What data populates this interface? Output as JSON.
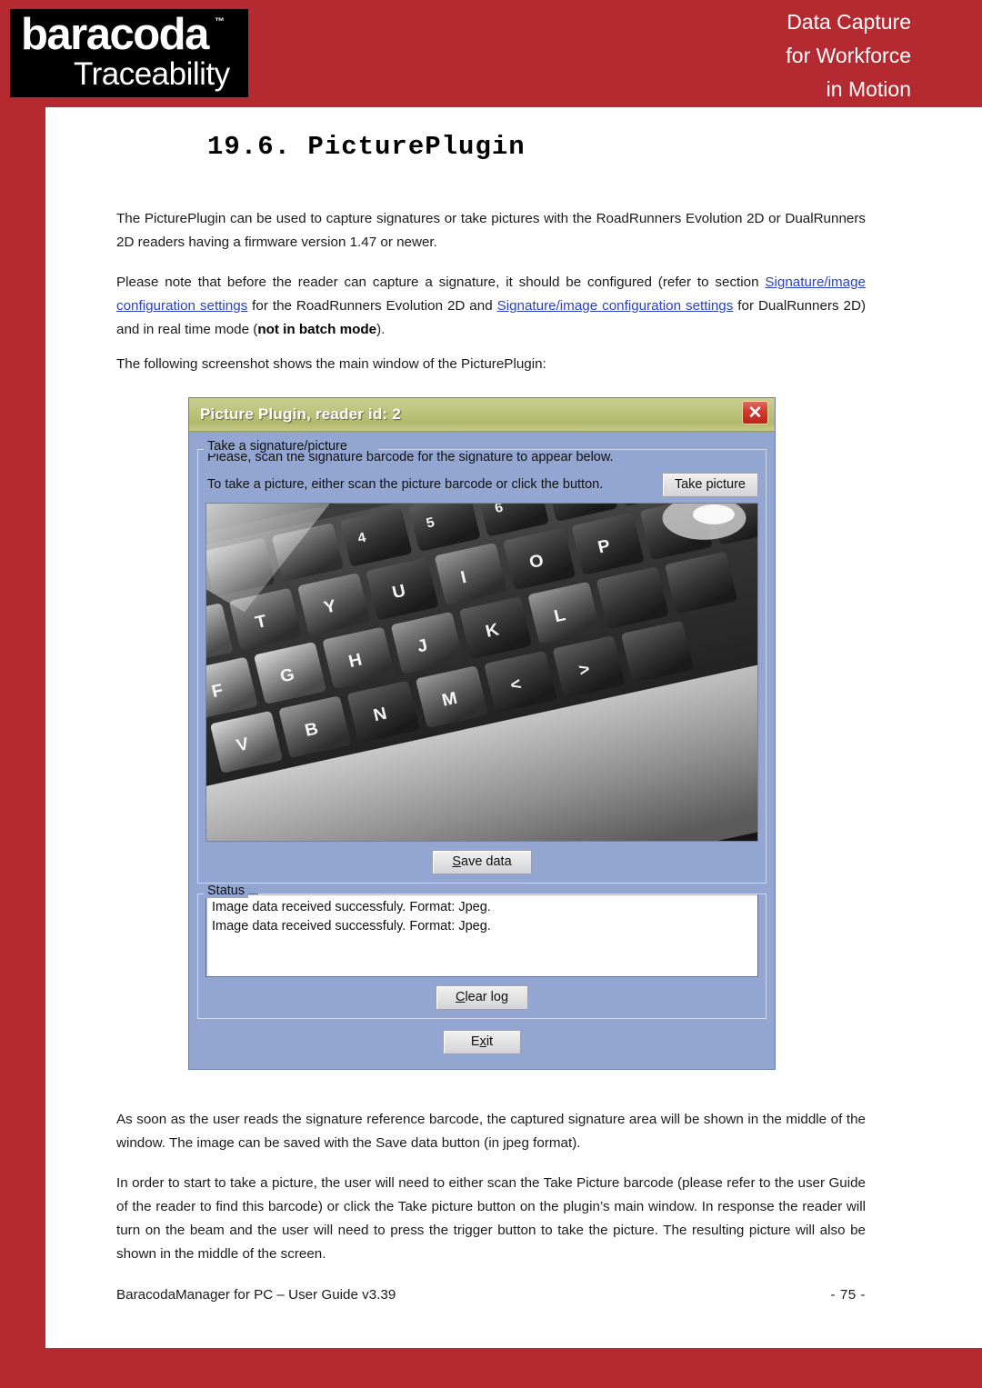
{
  "header": {
    "logo_word": "baracoda",
    "logo_tm": "™",
    "logo_sub": "Traceability",
    "tagline": [
      "Data Capture",
      "for Workforce",
      "in Motion"
    ],
    "brand_red": "#b52a30"
  },
  "document": {
    "section_heading": "19.6. PicturePlugin",
    "paragraphs": {
      "p1": "The PicturePlugin can be used to capture signatures or take pictures with the RoadRunners Evolution 2D or DualRunners 2D readers having a firmware version 1.47 or newer.",
      "p2_part1": "Please note that before the reader can capture a signature, it should be configured (refer to section ",
      "p2_link1": "Signature/image configuration settings",
      "p2_part2": " for the RoadRunners Evolution 2D and ",
      "p2_link2": "Signature/image configuration settings",
      "p2_part3": " for DualRunners 2D) and in real time mode (",
      "p2_bold": "not in batch mode",
      "p2_part4": ").",
      "p3": "The following screenshot shows the main window of the PicturePlugin:",
      "p4": "As soon as the user reads the signature reference barcode, the captured signature area will be shown in the middle of the window. The image can be saved with the Save data button (in jpeg format).",
      "p5": "In order to start to take a picture, the user will need to either scan the Take Picture barcode (please refer to the user Guide of the reader to find this barcode) or click the Take picture button on the plugin’s main window. In response the reader will turn on the beam and the user will need to press the trigger button to take the picture. The resulting picture will also be shown in the middle of the screen."
    },
    "link_color": "#2b41c4"
  },
  "footer": {
    "left": "BaracodaManager for PC – User Guide v3.39",
    "page": "- 75 -"
  },
  "dialog": {
    "title": "Picture Plugin, reader id: 2",
    "titlebar_color": "#bcc47c",
    "body_color": "#93a5d1",
    "close_label": "✕",
    "groups": {
      "capture": {
        "label": "Take a signature/picture",
        "line1": "Please, scan the signature barcode for the signature to appear below.",
        "line2": "To take a picture, either scan the picture barcode or click the button.",
        "take_picture_button": "Take picture",
        "save_data_button": "Save data",
        "photo_alt": "keyboard-photo"
      },
      "status": {
        "label": "Status",
        "log_lines": [
          "Image data received successfuly. Format: Jpeg.",
          "Image data received successfuly. Format: Jpeg."
        ],
        "clear_log_button": "Clear log"
      }
    },
    "exit_button": "Exit"
  }
}
